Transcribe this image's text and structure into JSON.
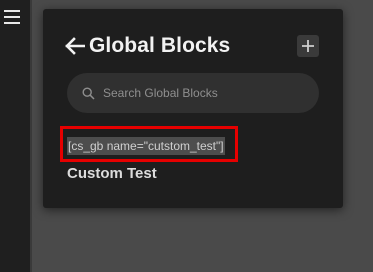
{
  "panel": {
    "title": "Global Blocks",
    "search": {
      "placeholder": "Search Global Blocks",
      "value": ""
    },
    "blocks": [
      {
        "shortcode": "[cs_gb name=\"cutstom_test\"]",
        "name": "Custom Test"
      }
    ]
  },
  "icons": {
    "menu": "hamburger-menu-icon",
    "back": "arrow-left-icon",
    "add": "plus-icon",
    "search": "search-icon"
  },
  "colors": {
    "panel_bg": "#1e1e1e",
    "search_bg": "#303030",
    "highlight": "#e60000",
    "text": "#f2f2f2"
  }
}
